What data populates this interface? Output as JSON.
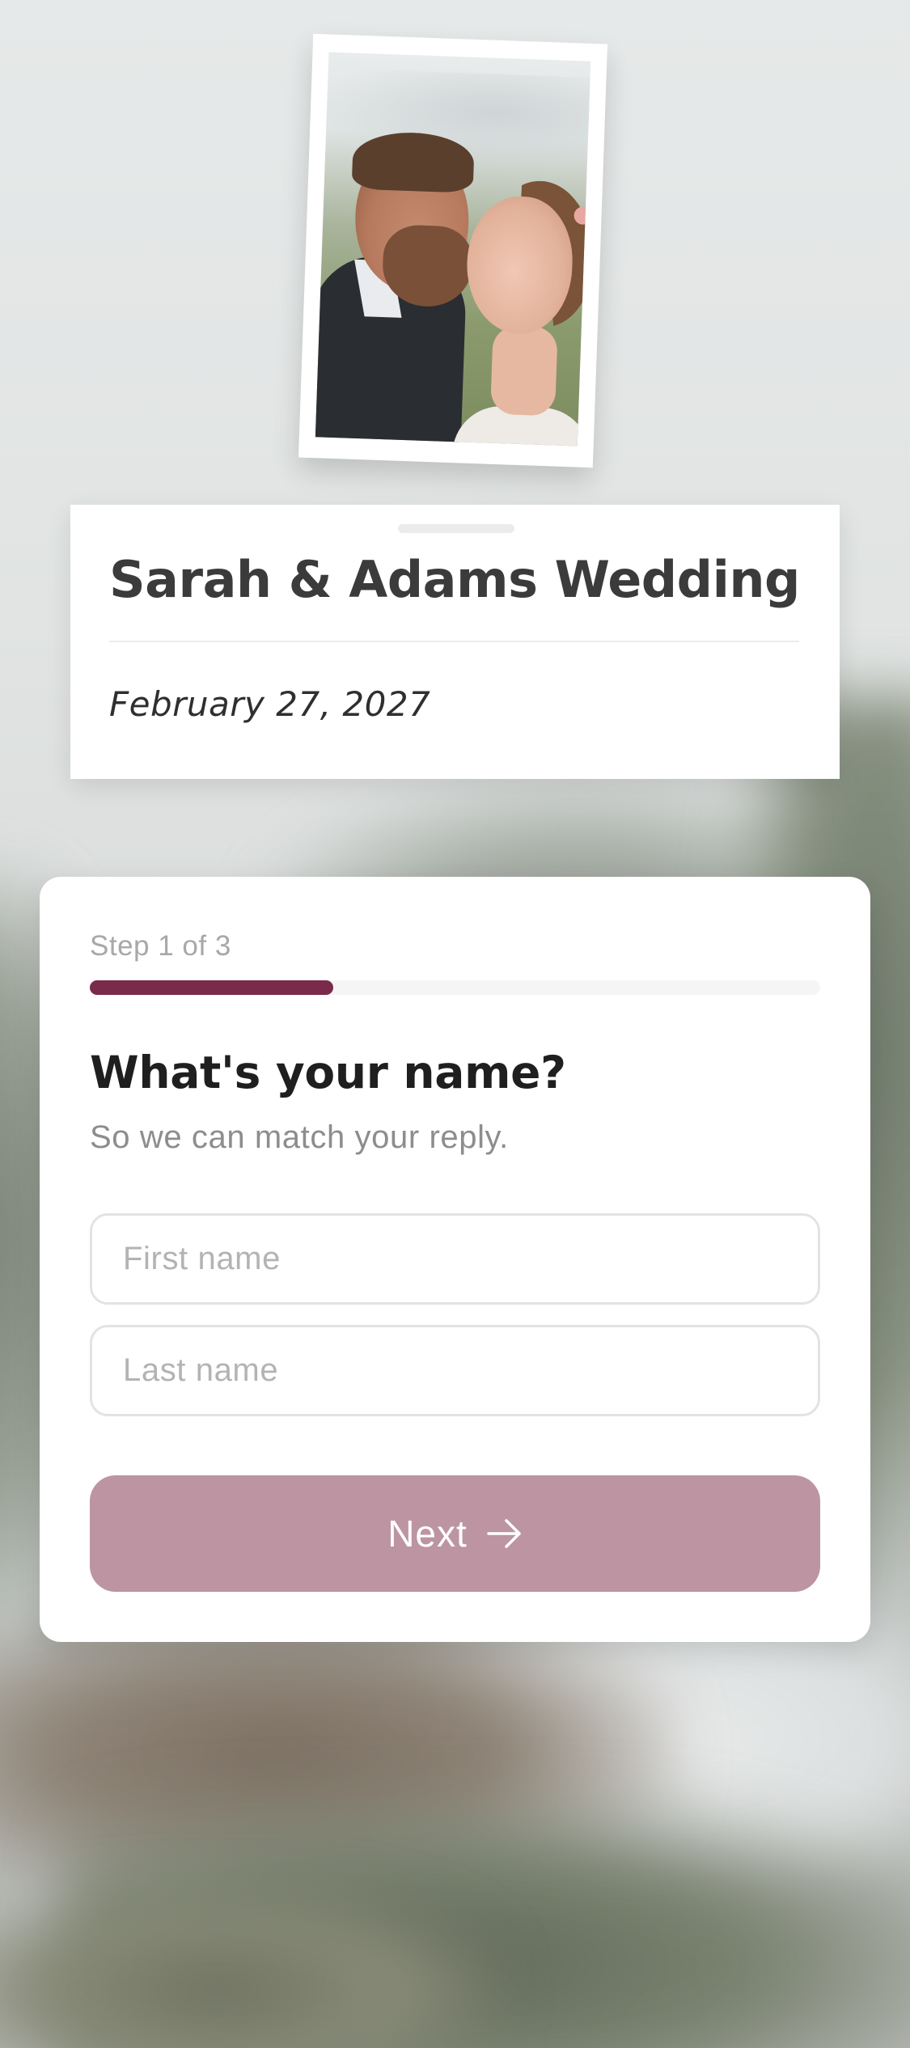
{
  "event": {
    "title": "Sarah & Adams Wedding",
    "date": "February 27, 2027"
  },
  "form": {
    "step_label": "Step 1 of 3",
    "progress": 0.333,
    "question": "What's your name?",
    "subtext": "So we can match your reply.",
    "first_name": {
      "value": "",
      "placeholder": "First name"
    },
    "last_name": {
      "value": "",
      "placeholder": "Last name"
    },
    "next_label": "Next",
    "next_icon": "arrow-right-icon"
  },
  "colors": {
    "accent": "#7a2a4a",
    "button": "#bd94a2",
    "title_text": "#3b3b3b"
  }
}
